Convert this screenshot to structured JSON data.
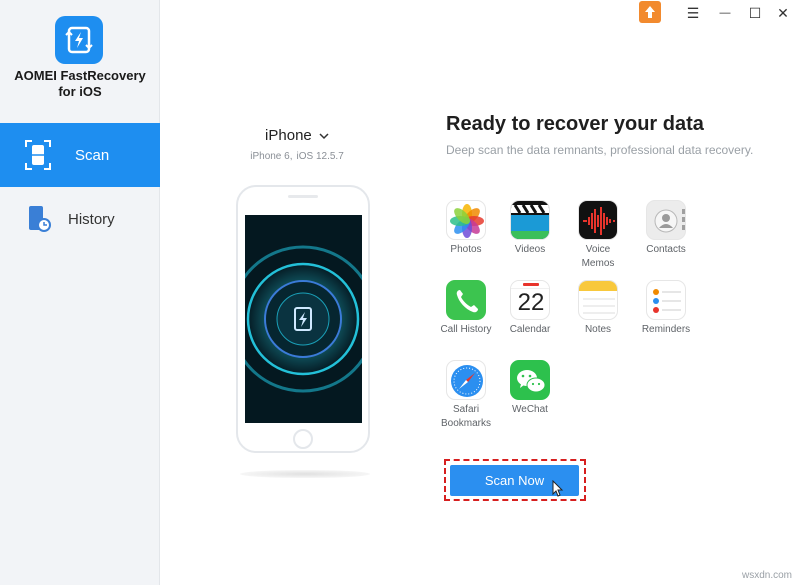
{
  "app": {
    "title_line1": "AOMEI FastRecovery",
    "title_line2": "for iOS",
    "brand_color": "#1e8ef0"
  },
  "window_controls": {
    "menu": "☰",
    "minimize": "—",
    "maximize": "☐",
    "close": "✕"
  },
  "sidebar": {
    "items": [
      {
        "label": "Scan",
        "icon": "scan-icon",
        "active": true
      },
      {
        "label": "History",
        "icon": "history-icon",
        "active": false
      }
    ]
  },
  "device": {
    "name": "iPhone",
    "model": "iPhone 6,",
    "ios": "iOS 12.5.7"
  },
  "main": {
    "headline": "Ready to recover your data",
    "subline": "Deep scan the data remnants, professional data recovery.",
    "data_types": [
      {
        "label": "Photos",
        "icon": "photos-icon"
      },
      {
        "label": "Videos",
        "icon": "videos-icon"
      },
      {
        "label": "Voice Memos",
        "icon": "voice-memos-icon"
      },
      {
        "label": "Contacts",
        "icon": "contacts-icon"
      },
      {
        "label": "Call History",
        "icon": "call-history-icon"
      },
      {
        "label": "Calendar",
        "icon": "calendar-icon",
        "day": "22"
      },
      {
        "label": "Notes",
        "icon": "notes-icon"
      },
      {
        "label": "Reminders",
        "icon": "reminders-icon"
      },
      {
        "label": "Safari Bookmarks",
        "icon": "safari-icon"
      },
      {
        "label": "WeChat",
        "icon": "wechat-icon"
      }
    ],
    "scan_button": "Scan Now"
  },
  "watermark": "wsxdn.com"
}
